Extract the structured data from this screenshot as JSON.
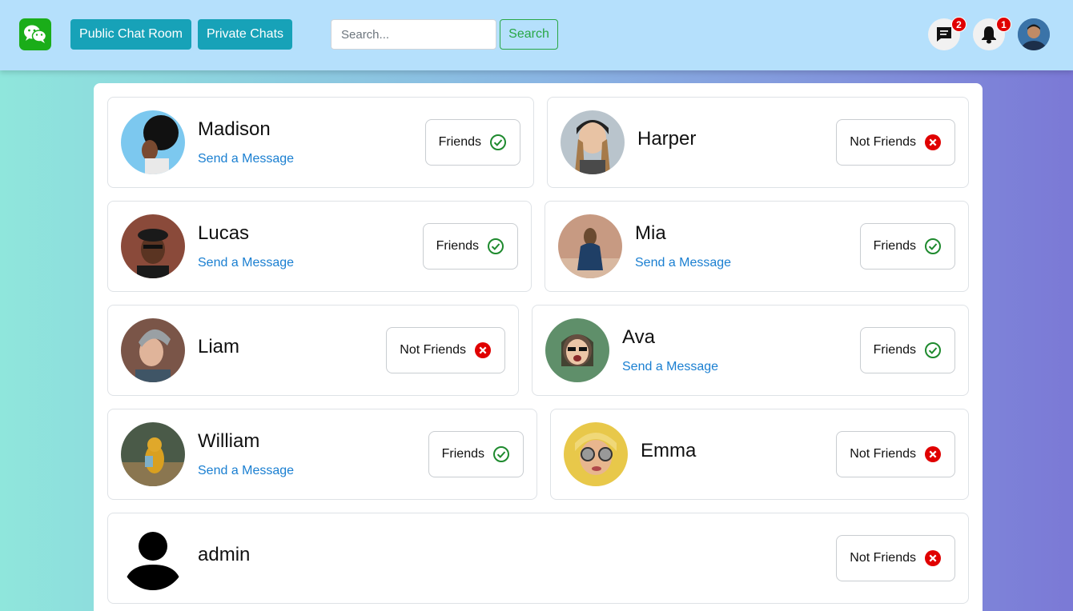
{
  "navbar": {
    "public_label": "Public Chat Room",
    "private_label": "Private Chats",
    "search_placeholder": "Search...",
    "search_button": "Search",
    "messages_badge": "2",
    "notifications_badge": "1",
    "icons": [
      "wechat-logo-icon",
      "message-icon",
      "bell-icon"
    ]
  },
  "colors": {
    "navbar_bg": "#b5e0fc",
    "primary_button": "#17a2b8",
    "search_button": "#28a745",
    "link": "#1a7fd1",
    "friends_check": "#1e8a2e",
    "not_friends_x": "#e00000"
  },
  "users": [
    {
      "name": "Madison",
      "link": "Send a Message",
      "status": "Friends"
    },
    {
      "name": "Harper",
      "link": "",
      "status": "Not Friends"
    },
    {
      "name": "Lucas",
      "link": "Send a Message",
      "status": "Friends"
    },
    {
      "name": "Mia",
      "link": "Send a Message",
      "status": "Friends"
    },
    {
      "name": "Liam",
      "link": "",
      "status": "Not Friends"
    },
    {
      "name": "Ava",
      "link": "Send a Message",
      "status": "Friends"
    },
    {
      "name": "William",
      "link": "Send a Message",
      "status": "Friends"
    },
    {
      "name": "Emma",
      "link": "",
      "status": "Not Friends"
    },
    {
      "name": "admin",
      "link": "",
      "status": "Not Friends"
    }
  ]
}
